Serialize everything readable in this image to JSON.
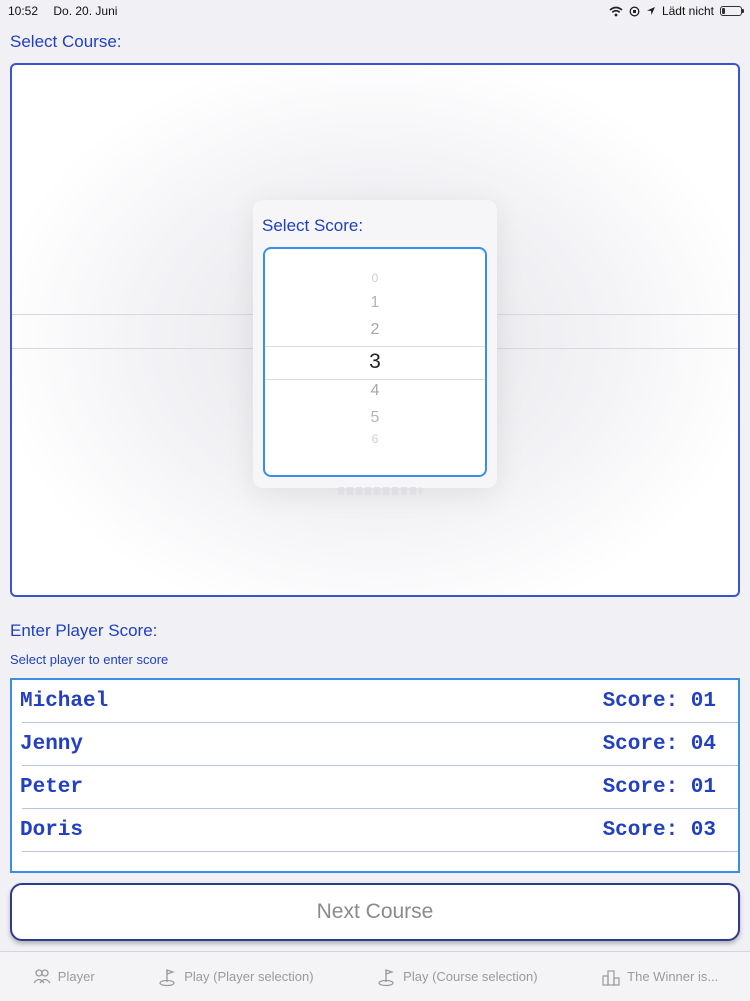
{
  "status_bar": {
    "time": "10:52",
    "date": "Do. 20. Juni",
    "charging_status": "Lädt nicht",
    "battery_level": 0.15
  },
  "course_section": {
    "title": "Select Course:"
  },
  "score_picker": {
    "title": "Select Score:",
    "values": [
      "0",
      "1",
      "2",
      "3",
      "4",
      "5",
      "6"
    ],
    "selected": "3"
  },
  "player_section": {
    "title": "Enter Player Score:",
    "subtitle": "Select player to enter score",
    "players": [
      {
        "name": "Michael",
        "score": "Score: 01"
      },
      {
        "name": "Jenny",
        "score": "Score: 04"
      },
      {
        "name": "Peter",
        "score": "Score: 01"
      },
      {
        "name": "Doris",
        "score": "Score: 03"
      }
    ]
  },
  "next_button": {
    "label": "Next Course"
  },
  "tab_bar": {
    "tabs": [
      {
        "label": "Player",
        "icon": "player-icon"
      },
      {
        "label": "Play (Player selection)",
        "icon": "golf-icon"
      },
      {
        "label": "Play (Course selection)",
        "icon": "golf-icon"
      },
      {
        "label": "The Winner is...",
        "icon": "podium-icon"
      }
    ]
  },
  "colors": {
    "accent": "#1f3fbf",
    "border": "#3a8ee6",
    "button_text": "#8a8a8e"
  }
}
